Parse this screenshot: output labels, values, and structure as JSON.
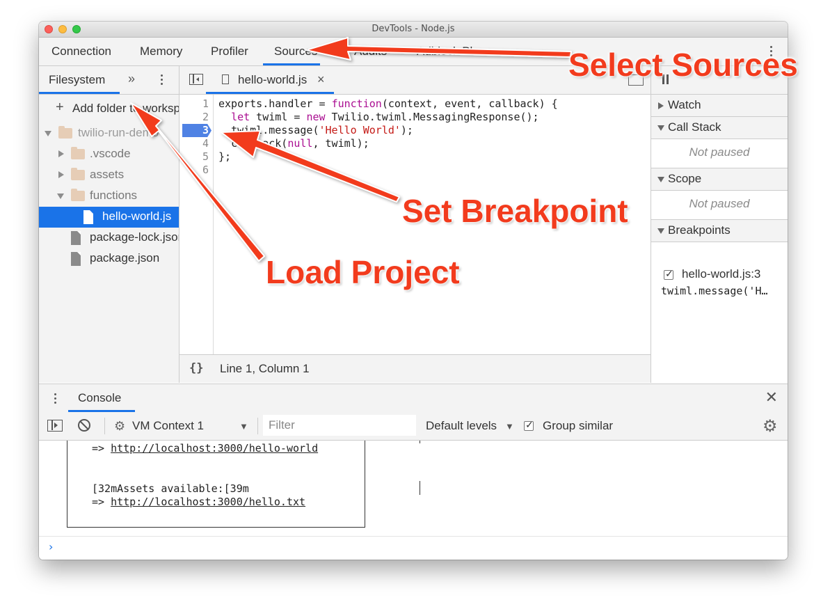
{
  "window": {
    "title": "DevTools - Node.js"
  },
  "main_tabs": [
    "Connection",
    "Memory",
    "Profiler",
    "Sources",
    "Audits",
    "Adblock Plus"
  ],
  "left_panel": {
    "tab": "Filesystem",
    "more_icon": "»",
    "add_folder_label": "Add folder to workspace",
    "tree": [
      {
        "label": "twilio-run-demo",
        "type": "folder",
        "expanded": true,
        "dim": true
      },
      {
        "label": ".vscode",
        "type": "folder",
        "expanded": false
      },
      {
        "label": "assets",
        "type": "folder",
        "expanded": false
      },
      {
        "label": "functions",
        "type": "folder",
        "expanded": true
      },
      {
        "label": "hello-world.js",
        "type": "file",
        "selected": true
      },
      {
        "label": "package-lock.json",
        "type": "file"
      },
      {
        "label": "package.json",
        "type": "file"
      }
    ]
  },
  "editor": {
    "tab_label": "hello-world.js",
    "close_icon": "×",
    "line_numbers": [
      "1",
      "2",
      "3",
      "4",
      "5",
      "6"
    ],
    "breakpoint_line": "3",
    "code": [
      {
        "n": "exports.handler = ",
        "kw": "function",
        "rest": "(context, event, callback) {"
      },
      {
        "indent": "  ",
        "kw": "let",
        "mid": " twiml = ",
        "kw2": "new",
        "rest": " Twilio.twiml.MessagingResponse();"
      },
      {
        "indent": "  ",
        "pre": "twiml.message(",
        "str": "'Hello World'",
        "rest": ");"
      },
      {
        "indent": "  ",
        "pre": "callback(",
        "kw": "null",
        "rest": ", twiml);"
      },
      {
        "pre": "};"
      },
      {
        "pre": ""
      }
    ],
    "status_braces": "{}",
    "status_position": "Line 1, Column 1"
  },
  "right_panel": {
    "sections": [
      {
        "label": "Watch",
        "expanded": false
      },
      {
        "label": "Call Stack",
        "expanded": true,
        "content": "Not paused"
      },
      {
        "label": "Scope",
        "expanded": true,
        "content": "Not paused"
      },
      {
        "label": "Breakpoints",
        "expanded": true
      }
    ],
    "breakpoint": {
      "label": "hello-world.js:3",
      "code": "twiml.message('H…",
      "checked": true
    }
  },
  "console": {
    "tab": "Console",
    "context": "VM Context 1",
    "filter_placeholder": "Filter",
    "levels": "Default levels",
    "group_similar": "Group similar",
    "group_similar_checked": true,
    "output": [
      {
        "prefix": "=> ",
        "link": "http://localhost:3000/hello-world"
      },
      {
        "text": "[32mAssets available:[39m"
      },
      {
        "prefix": "=> ",
        "link": "http://localhost:3000/hello.txt"
      }
    ],
    "prompt": "›"
  },
  "annotations": {
    "select_sources": "Select Sources",
    "set_breakpoint": "Set Breakpoint",
    "load_project": "Load Project"
  },
  "colors": {
    "accent": "#1a73e8",
    "annotation": "#f23b1d",
    "breakpoint": "#4f82e4"
  }
}
